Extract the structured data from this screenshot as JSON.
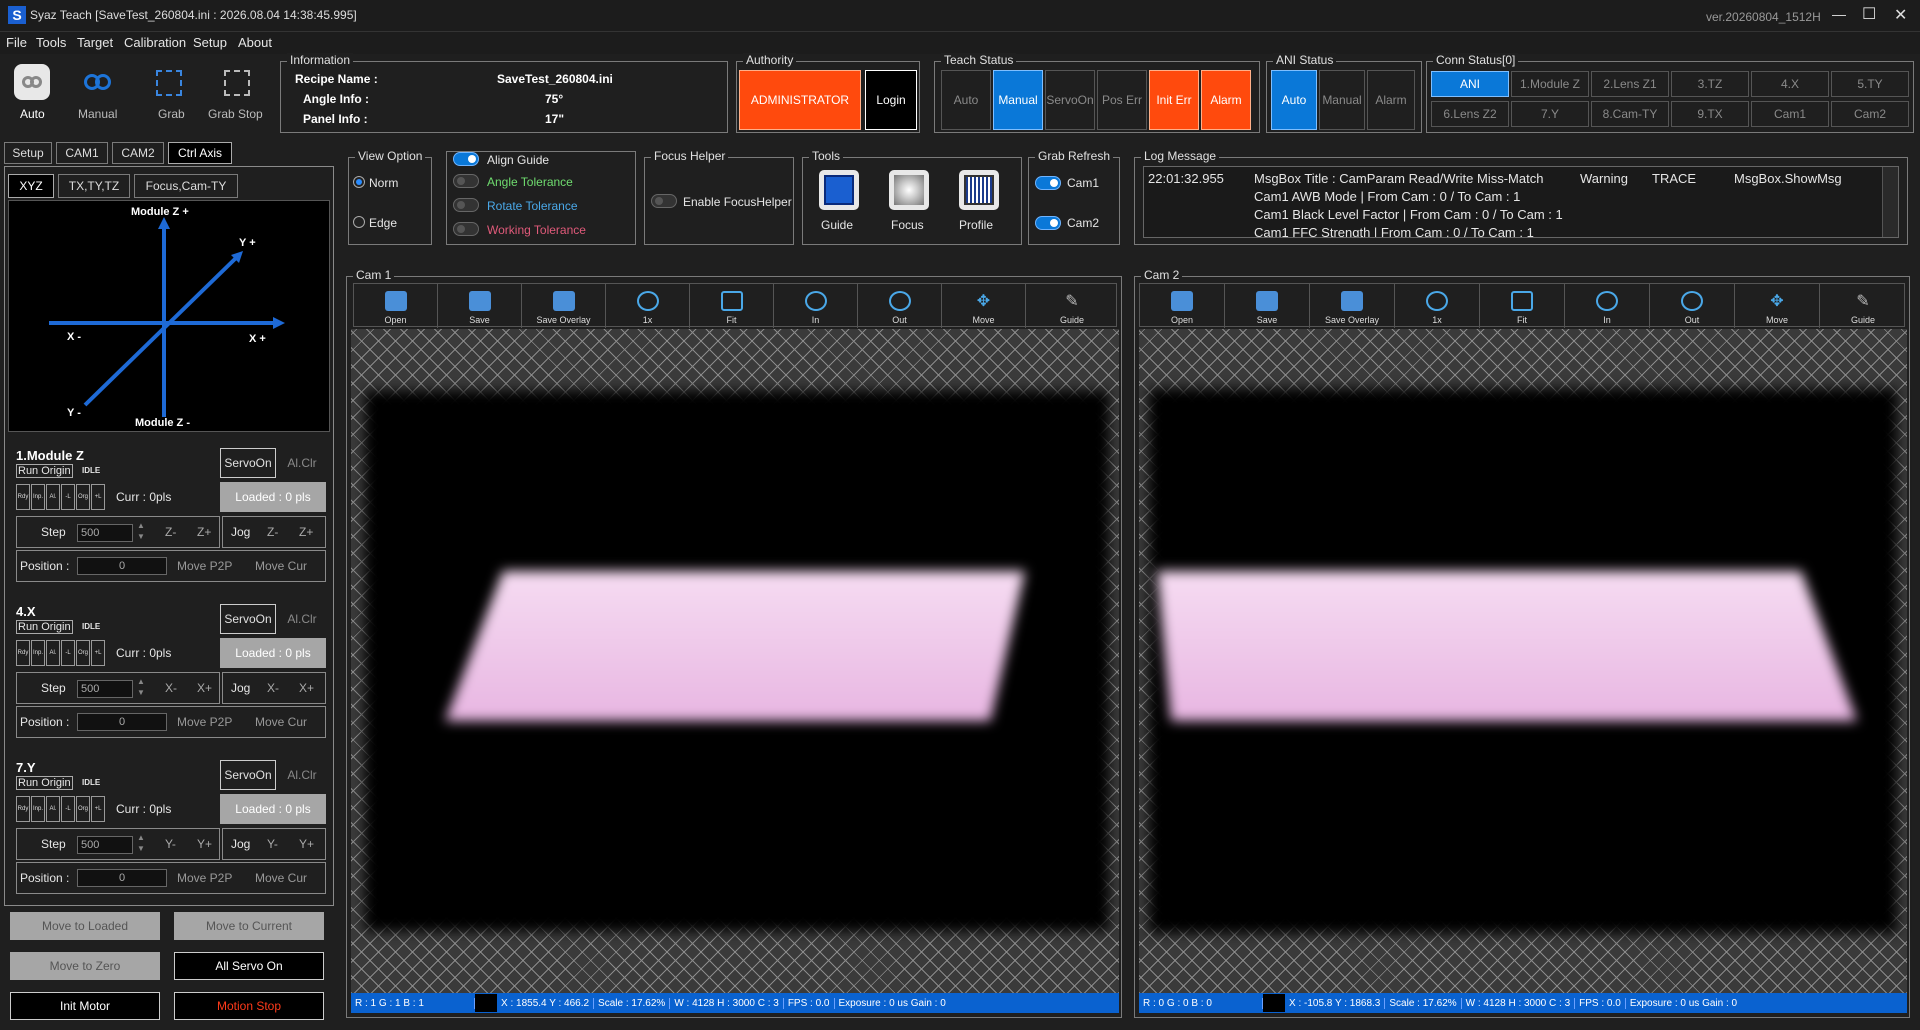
{
  "window": {
    "logo": "S",
    "title": "Syaz Teach [SaveTest_260804.ini : 2026.08.04 14:38:45.995]",
    "version": "ver.20260804_1512H",
    "minimize_glyph": "—",
    "maximize_glyph": "☐",
    "close_glyph": "✕"
  },
  "menu": [
    "File",
    "Tools",
    "Target",
    "Calibration",
    "Setup",
    "About"
  ],
  "mode_buttons": [
    {
      "label": "Auto",
      "icon": "auto-icon"
    },
    {
      "label": "Manual",
      "icon": "manual-icon"
    },
    {
      "label": "Grab",
      "icon": "grab-icon"
    },
    {
      "label": "Grab Stop",
      "icon": "grab-stop-icon"
    }
  ],
  "information": {
    "title": "Information",
    "recipe_label": "Recipe Name :",
    "recipe_value": "SaveTest_260804.ini",
    "angle_label": "Angle Info :",
    "angle_value": "75°",
    "panel_label": "Panel Info :",
    "panel_value": "17\""
  },
  "authority": {
    "title": "Authority",
    "role": "ADMINISTRATOR",
    "login": "Login"
  },
  "teach_status": {
    "title": "Teach Status",
    "items": [
      "Auto",
      "Manual",
      "ServoOn",
      "Pos Err",
      "Init Err",
      "Alarm"
    ]
  },
  "ani_status": {
    "title": "ANI Status",
    "items": [
      "Auto",
      "Manual",
      "Alarm"
    ]
  },
  "conn_status": {
    "title": "Conn Status[0]",
    "row1": [
      "ANI",
      "1.Module Z",
      "2.Lens Z1",
      "3.TZ",
      "4.X",
      "5.TY"
    ],
    "row2": [
      "6.Lens Z2",
      "7.Y",
      "8.Cam-TY",
      "9.TX",
      "Cam1",
      "Cam2"
    ]
  },
  "tabs": [
    "Setup",
    "CAM1",
    "CAM2",
    "Ctrl Axis"
  ],
  "subtabs": [
    "XYZ",
    "TX,TY,TZ",
    "Focus,Cam-TY"
  ],
  "diagram": {
    "z_plus": "Module Z +",
    "z_minus": "Module Z -",
    "y_plus": "Y +",
    "y_minus": "Y -",
    "x_minus": "X -",
    "x_plus": "X +"
  },
  "axes": [
    {
      "name": "1.Module Z",
      "minus": "Z-",
      "plus": "Z+"
    },
    {
      "name": "4.X",
      "minus": "X-",
      "plus": "X+"
    },
    {
      "name": "7.Y",
      "minus": "Y-",
      "plus": "Y+"
    }
  ],
  "axis_common": {
    "run_origin": "Run Origin",
    "idle": "IDLE",
    "servo_on": "ServoOn",
    "al_clr": "Al.Clr",
    "io": [
      "Rdy",
      "Inp.",
      "Al.",
      "-L",
      "Org",
      "+L"
    ],
    "curr": "Curr : 0pls",
    "loaded": "Loaded : 0 pls",
    "step": "Step",
    "step_value": "500",
    "jog": "Jog",
    "position": "Position :",
    "position_value": "0",
    "move_p2p": "Move P2P",
    "move_cur": "Move Cur"
  },
  "bottom_buttons": {
    "move_loaded": "Move to Loaded",
    "move_current": "Move to Current",
    "move_zero": "Move to Zero",
    "all_servo": "All Servo On",
    "init_motor": "Init Motor",
    "motion_stop": "Motion Stop"
  },
  "view_option": {
    "title": "View Option",
    "norm": "Norm",
    "edge": "Edge"
  },
  "guides": {
    "align": "Align Guide",
    "angle": "Angle Tolerance",
    "rotate": "Rotate Tolerance",
    "working": "Working Tolerance"
  },
  "focus_helper": {
    "title": "Focus Helper",
    "enable": "Enable FocusHelper"
  },
  "tools": {
    "title": "Tools",
    "guide": "Guide",
    "focus": "Focus",
    "profile": "Profile"
  },
  "grab_refresh": {
    "title": "Grab Refresh",
    "cam1": "Cam1",
    "cam2": "Cam2"
  },
  "log": {
    "title": "Log Message",
    "time": "22:01:32.955",
    "line1": "MsgBox Title : CamParam Read/Write Miss-Match",
    "warning": "Warning",
    "trace": "TRACE",
    "source": "MsgBox.ShowMsg",
    "line2": "Cam1 AWB Mode | From Cam : 0 / To Cam : 1",
    "line3": "Cam1 Black Level Factor | From Cam : 0 / To Cam : 1",
    "line4": "Cam1 FFC Strength | From Cam : 0 / To Cam : 1"
  },
  "cam_tools": [
    "Open",
    "Save",
    "Save Overlay",
    "1x",
    "Fit",
    "In",
    "Out",
    "Move",
    "Guide"
  ],
  "cam1": {
    "title": "Cam 1",
    "status": [
      "R : 1 G : 1 B : 1",
      "X : 1855.4  Y : 466.2",
      "Scale : 17.62%",
      "W : 4128  H : 3000  C : 3",
      "FPS : 0.0",
      "Exposure : 0 us  Gain : 0"
    ]
  },
  "cam2": {
    "title": "Cam 2",
    "status": [
      "R : 0 G : 0 B : 0",
      "X : -105.8  Y : 1868.3",
      "Scale : 17.62%",
      "W : 4128  H : 3000  C : 3",
      "FPS : 0.0",
      "Exposure : 0 us  Gain : 0"
    ]
  },
  "colors": {
    "accent": "#0a78d8",
    "alarm": "#ff4a0d",
    "status_bar": "#0a62d0"
  }
}
